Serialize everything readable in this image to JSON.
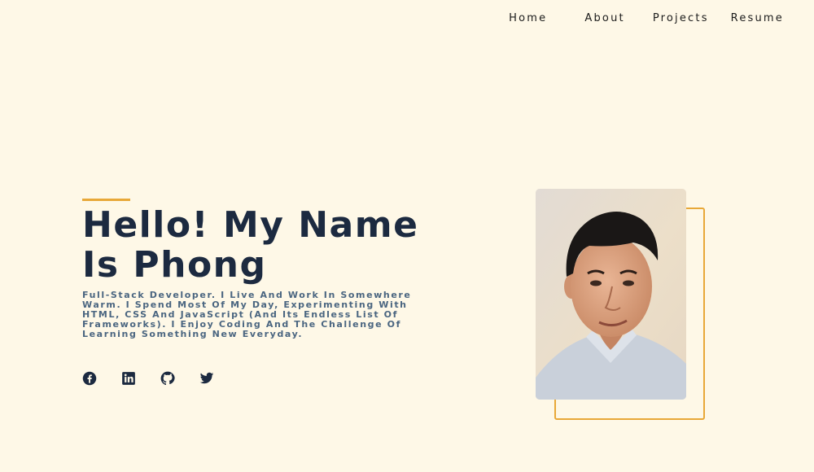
{
  "nav": {
    "items": [
      {
        "label": "Home"
      },
      {
        "label": "About"
      },
      {
        "label": "Projects"
      },
      {
        "label": "Resume"
      }
    ]
  },
  "hero": {
    "title_line1": "Hello! My Name",
    "title_line2": "Is Phong",
    "description": "Full-Stack Developer. I Live And Work In Somewhere Warm. I Spend Most Of My Day, Experimenting With HTML, CSS And JavaScript (And Its Endless List Of Frameworks). I Enjoy Coding And The Challenge Of Learning Something New Everyday."
  },
  "socials": [
    {
      "icon": "facebook-icon"
    },
    {
      "icon": "linkedin-icon"
    },
    {
      "icon": "github-icon"
    },
    {
      "icon": "twitter-icon"
    }
  ],
  "colors": {
    "background": "#fef8e7",
    "accent": "#e8a838",
    "heading": "#1c2a40",
    "description": "#4a6580",
    "icon": "#1c2a40"
  }
}
